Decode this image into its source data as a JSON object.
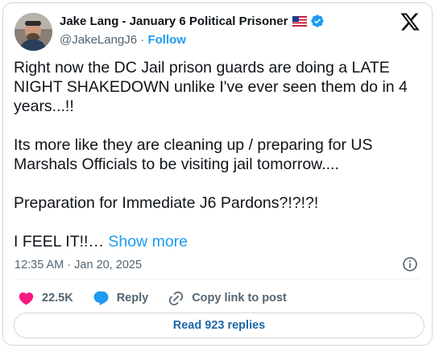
{
  "author": {
    "name": "Jake Lang - January 6 Political Prisoner",
    "handle": "@JakeLangJ6",
    "separator": "·",
    "follow_label": "Follow",
    "flag_icon": "us-flag-icon",
    "verified_icon": "verified-badge-icon",
    "avatar_icon": "avatar"
  },
  "brand_icon": "x-logo-icon",
  "tweet": {
    "line1": "Right now the DC Jail prison guards are doing a LATE NIGHT SHAKEDOWN unlike I've ever seen them do in 4 years...!!",
    "line2": "Its more like they are cleaning up / preparing for US Marshals Officials to be visiting jail tomorrow....",
    "line3": "Preparation for Immediate J6 Pardons?!?!?!",
    "line4": "I FEEL IT!!…",
    "show_more": "Show more"
  },
  "timestamp": {
    "time": "12:35 AM",
    "separator": "·",
    "date": "Jan 20, 2025"
  },
  "actions": {
    "likes_count": "22.5K",
    "reply_label": "Reply",
    "copy_link_label": "Copy link to post"
  },
  "replies_button_label": "Read 923 replies",
  "colors": {
    "accent": "#1d9bf0",
    "like": "#f91880",
    "text": "#0f1419",
    "muted": "#536471",
    "border": "#cfd9de"
  }
}
